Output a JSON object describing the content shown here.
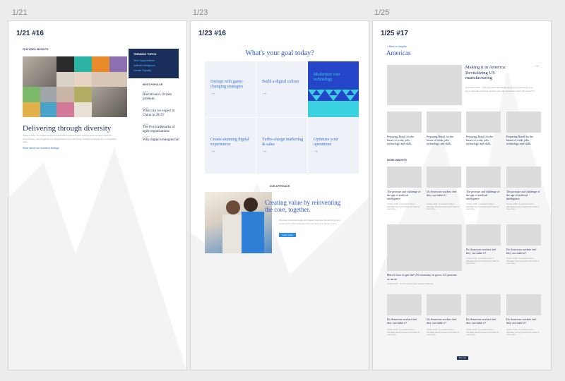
{
  "boards": [
    {
      "date": "1/21",
      "label": "1/21 #16"
    },
    {
      "date": "1/23",
      "label": "1/23 #16"
    },
    {
      "date": "1/25",
      "label": "1/25 #17"
    }
  ],
  "b1": {
    "eyebrow": "FEATURED INSIGHTS",
    "headline": "Delivering through diversity",
    "body": "January 2018 · Our latest research reinforces the link between diversity and company financial performance—and suggests how organizations can craft better inclusion strategies for a competitive edge.",
    "link": "Read about our research findings",
    "trending_title": "TRENDING TOPICS",
    "trending": [
      "Tech Organizations",
      "Artificial Intelligence",
      "Gender Equality"
    ],
    "popular_title": "MOST POPULAR",
    "popular": [
      {
        "tag": "Article",
        "title": "Blockchain's Occam problem"
      },
      {
        "tag": "Article",
        "title": "What can we expect in China in 2019?"
      },
      {
        "tag": "Article",
        "title": "The five trademarks of agile organizations"
      },
      {
        "tag": "Article",
        "title": "Why digital strategies fail"
      }
    ]
  },
  "b2": {
    "title": "What's your goal today?",
    "goals": [
      "Disrupt with game-changing strategies",
      "Build a digital culture",
      "Modernize core technology",
      "Create stunning digital experiences",
      "Turbo-charge marketing & sales",
      "Optimize your operations"
    ],
    "arrow": "→",
    "approach_eyebrow": "OUR APPROACH",
    "approach_title": "Creating value by reinventing the core, together.",
    "approach_body": "We know how technology and digital trends are transforming your environment. We'll empower both you and your clients to win.",
    "approach_button": "Learn more"
  },
  "b3": {
    "back": "< Back to Insights",
    "title": "Americas",
    "hero_title": "Making it in America: Revitalizing US manufacturing",
    "hero_body": "November 2017 · The American manufacturing sector's resurgence is a key to broader economic growth. How can companies seize the moment?",
    "cards4": [
      "Preparing Brazil for the future of work, jobs, technology, and skills",
      "Preparing Brazil for the future of work, jobs, technology, and skills",
      "Preparing Brazil for the future of work, jobs, technology, and skills",
      "Preparing Brazil for the future of work, jobs, technology, and skills"
    ],
    "more_label": "MORE INSIGHTS",
    "row1": [
      "The promise and challenge of the age of artificial intelligence",
      "Do American workers feel they can make it?",
      "The promise and challenge of the age of artificial intelligence",
      "The promise and challenge of the age of artificial intelligence"
    ],
    "big_title": "Here's how to get the US economy to grow 3.5 percent or more",
    "big_body": "October 2018 · The US economy faces a growth challenge.",
    "row2_side": [
      "Do American workers feel they can make it?",
      "Do American workers feel they can make it?"
    ],
    "row3": [
      "Do American workers feel they can make it?",
      "Do American workers feel they can make it?",
      "Do American workers feel they can make it?",
      "Do American workers feel they can make it?"
    ],
    "card_body": "October 2018 · A persistent crisis in affordable housing threatens the health of many cities.",
    "see_more": "See more"
  },
  "colors": {
    "navy": "#1a2e5c",
    "blue": "#2f6ae0",
    "teal": "#3ad2e0",
    "tile": "#eef2f8"
  }
}
